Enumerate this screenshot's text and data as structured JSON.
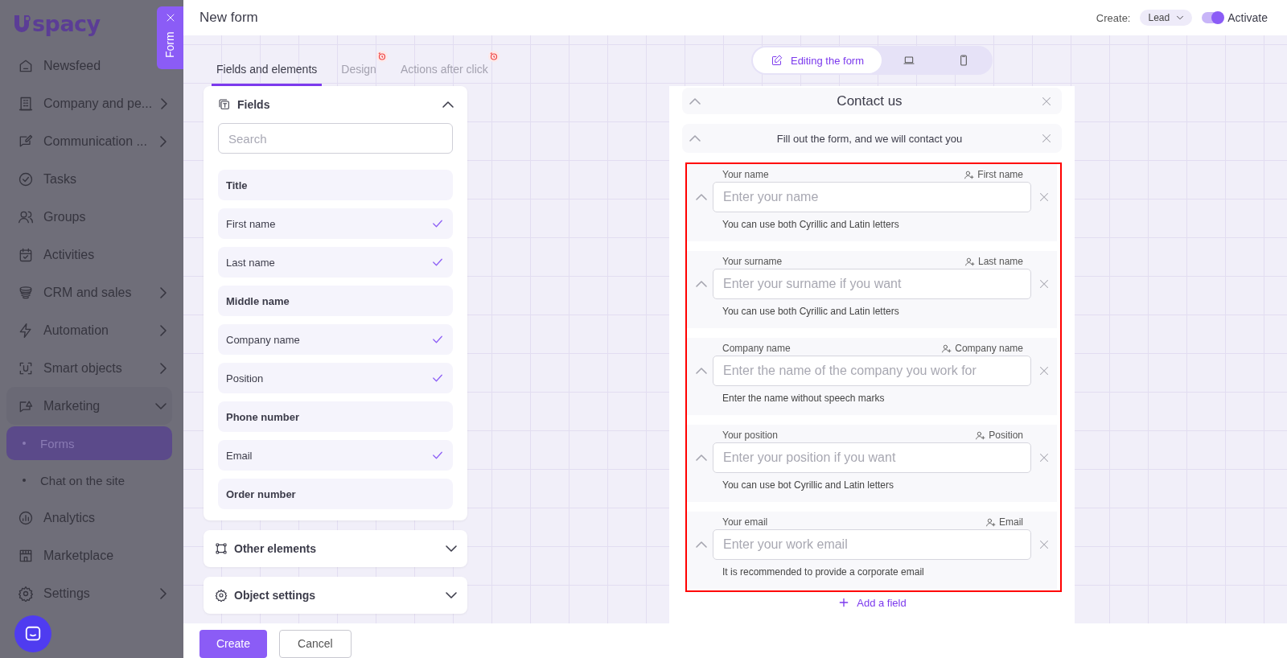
{
  "sidebar": {
    "logo": "spacy",
    "form_tab": "Form",
    "items": [
      {
        "label": "Newsfeed",
        "kind": "link"
      },
      {
        "label": "Company and pe...",
        "kind": "group",
        "expanded": false
      },
      {
        "label": "Communication ...",
        "kind": "group",
        "expanded": false
      },
      {
        "label": "Tasks",
        "kind": "link"
      },
      {
        "label": "Groups",
        "kind": "link"
      },
      {
        "label": "Activities",
        "kind": "link"
      },
      {
        "label": "CRM and sales",
        "kind": "group",
        "expanded": false
      },
      {
        "label": "Automation",
        "kind": "group",
        "expanded": false
      },
      {
        "label": "Smart objects",
        "kind": "group",
        "expanded": false
      },
      {
        "label": "Marketing",
        "kind": "group",
        "expanded": true,
        "children": [
          {
            "label": "Forms",
            "selected": true
          },
          {
            "label": "Chat on the site",
            "selected": false
          }
        ]
      },
      {
        "label": "Analytics",
        "kind": "link"
      },
      {
        "label": "Marketplace",
        "kind": "link"
      },
      {
        "label": "Settings",
        "kind": "group",
        "expanded": false
      }
    ]
  },
  "header": {
    "title": "New form",
    "create_label": "Create:",
    "create_value": "Lead",
    "activate": {
      "label": "Activate",
      "on": true
    }
  },
  "tabs": [
    {
      "label": "Fields and elements",
      "selected": true,
      "warning": false
    },
    {
      "label": "Design",
      "selected": false,
      "warning": true
    },
    {
      "label": "Actions after click",
      "selected": false,
      "warning": true
    }
  ],
  "view_switch": [
    {
      "kind": "edit",
      "label": "Editing the form",
      "selected": true
    },
    {
      "kind": "desktop",
      "selected": false
    },
    {
      "kind": "mobile",
      "selected": false
    }
  ],
  "fields_panel": {
    "title": "Fields",
    "expanded": true,
    "search": {
      "placeholder": "Search"
    },
    "items": [
      {
        "label": "Title",
        "checked": false
      },
      {
        "label": "First name",
        "checked": true
      },
      {
        "label": "Last name",
        "checked": true
      },
      {
        "label": "Middle name",
        "checked": false
      },
      {
        "label": "Company name",
        "checked": true
      },
      {
        "label": "Position",
        "checked": true
      },
      {
        "label": "Phone number",
        "checked": false
      },
      {
        "label": "Email",
        "checked": true
      },
      {
        "label": "Order number",
        "checked": false
      }
    ]
  },
  "sections": [
    {
      "title": "Other elements",
      "expanded": false
    },
    {
      "title": "Object settings",
      "expanded": false
    }
  ],
  "form_preview": {
    "title": "Contact us",
    "subtitle": "Fill out the form, and we will contact you",
    "highlighted": true,
    "fields": [
      {
        "label": "Your name",
        "mapping": "First name",
        "placeholder": "Enter your name",
        "hint": "You can use both Cyrillic and Latin letters"
      },
      {
        "label": "Your surname",
        "mapping": "Last name",
        "placeholder": "Enter your surname if you want",
        "hint": "You can use both Cyrillic and Latin letters"
      },
      {
        "label": "Company name",
        "mapping": "Company name",
        "placeholder": "Enter the name of the company you work for",
        "hint": "Enter the name without speech marks"
      },
      {
        "label": "Your position",
        "mapping": "Position",
        "placeholder": "Enter your position if you want",
        "hint": "You can use bot Cyrillic and Latin letters"
      },
      {
        "label": "Your email",
        "mapping": "Email",
        "placeholder": "Enter your work email",
        "hint": "It is recommended to provide a corporate email"
      }
    ],
    "add_field": "Add a field"
  },
  "footer": {
    "buttons": [
      {
        "label": "Create",
        "kind": "primary"
      },
      {
        "label": "Cancel",
        "kind": "secondary"
      }
    ]
  }
}
